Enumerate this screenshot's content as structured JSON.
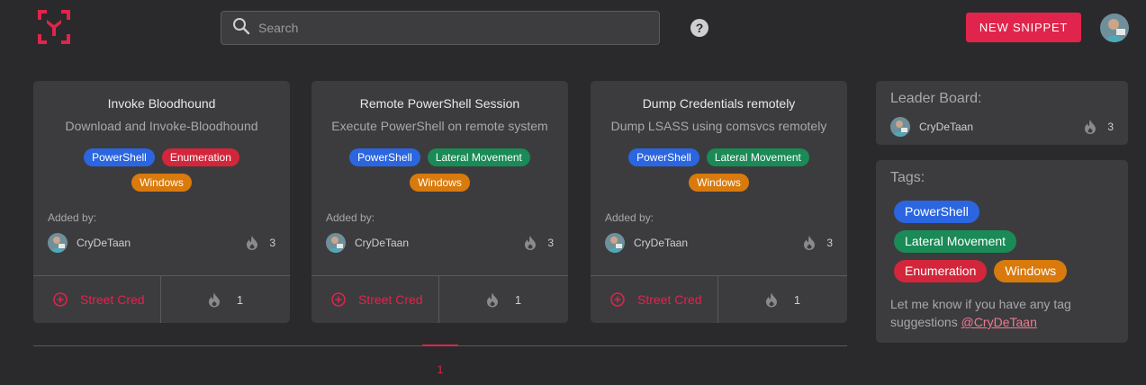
{
  "header": {
    "search_placeholder": "Search",
    "help_label": "?",
    "new_snippet_label": "NEW SNIPPET",
    "brand_color": "#e0244b"
  },
  "cards": [
    {
      "title": "Invoke Bloodhound",
      "description": "Download and Invoke-Bloodhound",
      "tags": [
        "PowerShell",
        "Enumeration",
        "Windows"
      ],
      "added_by_label": "Added by:",
      "author": "CryDeTaan",
      "author_score": "3",
      "street_cred_label": "Street Cred",
      "likes": "1"
    },
    {
      "title": "Remote PowerShell Session",
      "description": "Execute PowerShell on remote system",
      "tags": [
        "PowerShell",
        "Lateral Movement",
        "Windows"
      ],
      "added_by_label": "Added by:",
      "author": "CryDeTaan",
      "author_score": "3",
      "street_cred_label": "Street Cred",
      "likes": "1"
    },
    {
      "title": "Dump Credentials remotely",
      "description": "Dump LSASS using comsvcs remotely",
      "tags": [
        "PowerShell",
        "Lateral Movement",
        "Windows"
      ],
      "added_by_label": "Added by:",
      "author": "CryDeTaan",
      "author_score": "3",
      "street_cred_label": "Street Cred",
      "likes": "1"
    }
  ],
  "pagination": {
    "current_page": "1"
  },
  "leaderboard": {
    "title": "Leader Board:",
    "entries": [
      {
        "name": "CryDeTaan",
        "score": "3"
      }
    ]
  },
  "tags_panel": {
    "title": "Tags:",
    "tags": [
      "PowerShell",
      "Lateral Movement",
      "Enumeration",
      "Windows"
    ],
    "note_text": "Let me know if you have any tag suggestions ",
    "note_link": "@CryDeTaan"
  },
  "tag_colors": {
    "PowerShell": "#2b66e0",
    "Lateral Movement": "#1a8a56",
    "Enumeration": "#d3263a",
    "Windows": "#d97a0c"
  }
}
